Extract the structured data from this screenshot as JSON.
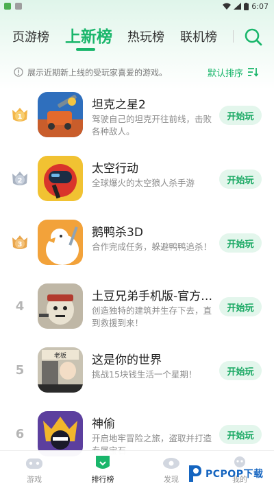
{
  "status_bar": {
    "time": "6:07"
  },
  "tabs": [
    {
      "label": "页游榜",
      "active": false
    },
    {
      "label": "上新榜",
      "active": true
    },
    {
      "label": "热玩榜",
      "active": false
    },
    {
      "label": "联机榜",
      "active": false
    }
  ],
  "description": "展示近期新上线的受玩家喜爱的游戏。",
  "sort_label": "默认排序",
  "play_label": "开始玩",
  "games": [
    {
      "rank": "1",
      "name": "坦克之星2",
      "desc": "驾驶自己的坦克开往前线，击败各种敌人。"
    },
    {
      "rank": "2",
      "name": "太空行动",
      "desc": "全球爆火的太空狼人杀手游"
    },
    {
      "rank": "3",
      "name": "鹅鸭杀3D",
      "desc": "合作完成任务，躲避鸭鸭追杀！"
    },
    {
      "rank": "4",
      "name": "土豆兄弟手机版-官方…",
      "desc": "创造独特的建筑并生存下去，直到救援到来！"
    },
    {
      "rank": "5",
      "name": "这是你的世界",
      "desc": "挑战15块钱生活一个星期！"
    },
    {
      "rank": "6",
      "name": "神偷",
      "desc": "开启地牢冒险之旅，盗取并打造专属宝石"
    }
  ],
  "icon_texts": {
    "game5_top": "老板"
  },
  "bottom_nav": [
    {
      "label": "游戏",
      "active": false
    },
    {
      "label": "排行榜",
      "active": true
    },
    {
      "label": "发现",
      "active": false
    },
    {
      "label": "我的",
      "active": false
    }
  ],
  "watermark": "PCPOP下载",
  "colors": {
    "accent": "#19b66b",
    "play_bg": "#e3f6ec",
    "gold": "#f0a93b",
    "silver": "#a9b3c2"
  }
}
